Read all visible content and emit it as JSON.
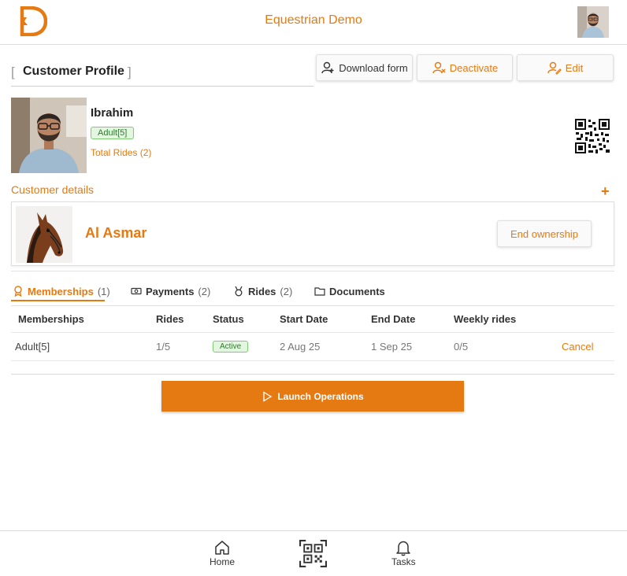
{
  "header": {
    "app_title": "Equestrian Demo",
    "logo_icon": "d-logo-icon",
    "avatar_icon": "user-avatar"
  },
  "profile": {
    "title": "Customer Profile",
    "bracket_left": "[",
    "bracket_right": "]",
    "buttons": {
      "download": "Download form",
      "deactivate": "Deactivate",
      "edit": "Edit"
    }
  },
  "customer": {
    "name": "Ibrahim",
    "badge": "Adult[5]",
    "total_rides": "Total Rides (2)"
  },
  "details": {
    "label": "Customer details",
    "add": "+",
    "horse_name": "Al Asmar",
    "end_ownership": "End ownership"
  },
  "tabs": [
    {
      "label": "Memberships",
      "count": "(1)",
      "icon": "award-icon"
    },
    {
      "label": "Payments",
      "count": "(2)",
      "icon": "cash-icon"
    },
    {
      "label": "Rides",
      "count": "(2)",
      "icon": "medal-icon"
    },
    {
      "label": "Documents",
      "count": "",
      "icon": "folder-icon"
    }
  ],
  "table": {
    "headers": [
      "Memberships",
      "Rides",
      "Status",
      "Start Date",
      "End Date",
      "Weekly rides"
    ],
    "rows": [
      {
        "membership": "Adult[5]",
        "rides": "1/5",
        "status": "Active",
        "start": "2 Aug 25",
        "end": "1 Sep 25",
        "weekly": "0/5",
        "action": "Cancel"
      }
    ]
  },
  "launch_label": "Launch Operations",
  "nav": {
    "home": "Home",
    "qr": "",
    "tasks": "Tasks"
  },
  "colors": {
    "accent": "#e57a12",
    "active_green": "#2f7a2f"
  }
}
